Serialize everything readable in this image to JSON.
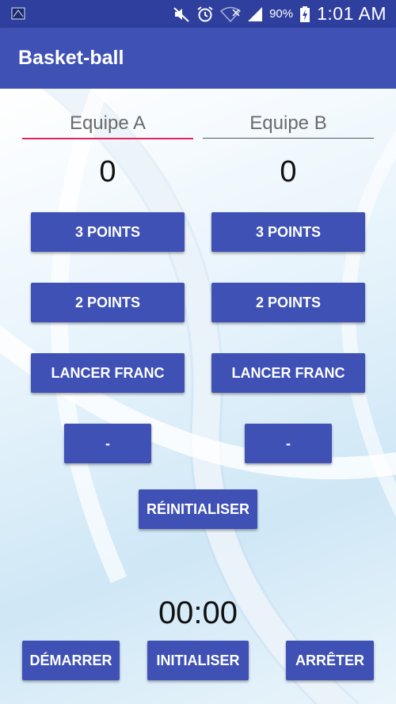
{
  "status_bar": {
    "icons": [
      "app-icon",
      "mute-icon",
      "alarm-icon",
      "wifi-icon",
      "signal-icon"
    ],
    "battery_percent": "90%",
    "time": "1:01 AM"
  },
  "app_bar": {
    "title": "Basket-ball"
  },
  "teams": [
    {
      "name": "Equipe A",
      "score": "0",
      "btn_3": "3 POINTS",
      "btn_2": "2 POINTS",
      "btn_ft": "LANCER FRANC",
      "btn_minus": "-"
    },
    {
      "name": "Equipe B",
      "score": "0",
      "btn_3": "3 POINTS",
      "btn_2": "2 POINTS",
      "btn_ft": "LANCER FRANC",
      "btn_minus": "-"
    }
  ],
  "reset_label": "RÉINITIALISER",
  "timer": {
    "value": "00:00",
    "start_label": "DÉMARRER",
    "init_label": "INITIALISER",
    "stop_label": "ARRÊTER"
  },
  "colors": {
    "primary": "#3f51b5",
    "primary_dark": "#2f3f9e",
    "accent": "#e0245e"
  }
}
